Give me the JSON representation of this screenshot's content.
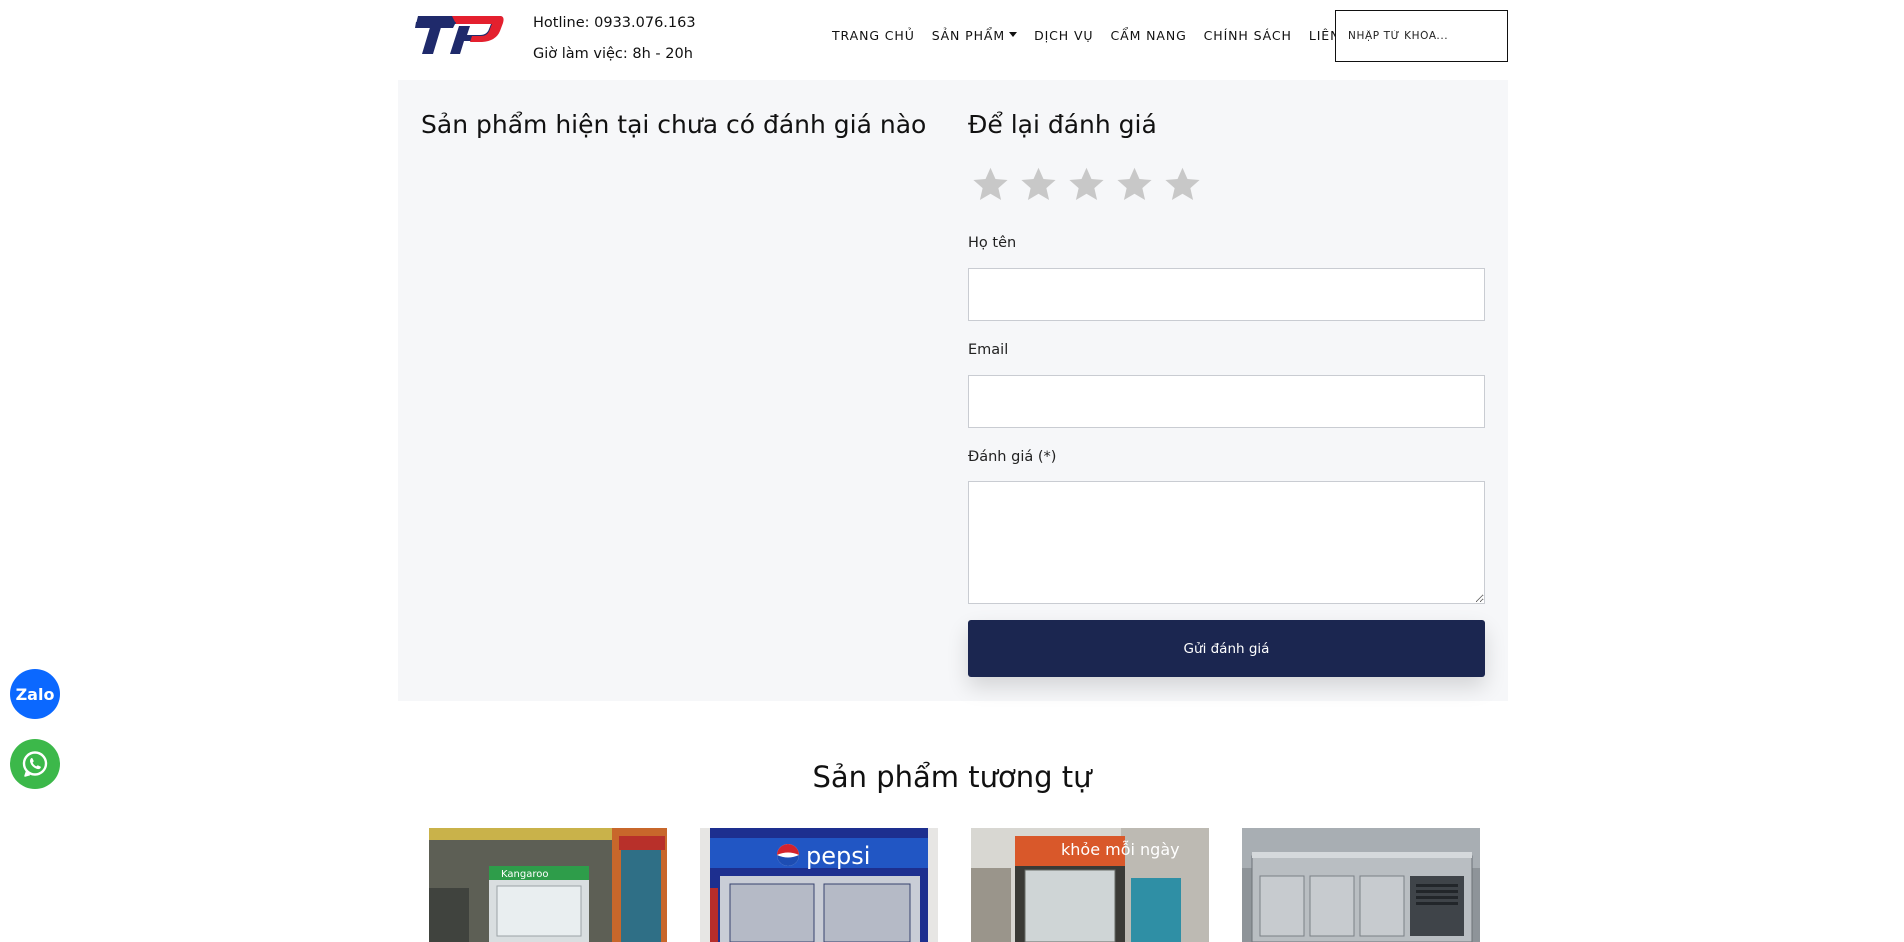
{
  "header": {
    "logo_text": "TP",
    "hotline": "Hotline: 0933.076.163",
    "hours": "Giờ làm việc: 8h - 20h",
    "nav": [
      {
        "label": "TRANG CHỦ"
      },
      {
        "label": "SẢN PHẨM"
      },
      {
        "label": "DỊCH VỤ"
      },
      {
        "label": "CẨM NANG"
      },
      {
        "label": "CHÍNH SÁCH"
      },
      {
        "label": "LIÊN HỆ"
      }
    ],
    "search_placeholder": "NHẬP TỪ KHÓA..."
  },
  "reviews": {
    "empty_message": "Sản phẩm hiện tại chưa có đánh giá nào",
    "form_title": "Để lại đánh giá",
    "rating": 0,
    "max_rating": 5,
    "name_label": "Họ tên",
    "name_value": "",
    "email_label": "Email",
    "email_value": "",
    "review_label": "Đánh giá (*)",
    "review_value": "",
    "submit_label": "Gửi đánh giá"
  },
  "floating": {
    "zalo_label": "Zalo"
  },
  "similar": {
    "title": "Sản phẩm tương tự",
    "products": [
      {
        "image_text": "Kangaroo"
      },
      {
        "image_text": "pepsi"
      },
      {
        "image_text": "khỏe mỗi ngày"
      },
      {
        "image_text": ""
      }
    ]
  },
  "colors": {
    "brand_navy": "#1b2650",
    "logo_red": "#e4202e",
    "panel_bg": "#f6f7f9",
    "star_inactive": "#c8c8c8",
    "zalo_blue": "#0b68ff",
    "whatsapp_green": "#3cb84a"
  },
  "icons": {
    "star": "star-icon",
    "zalo": "zalo-icon",
    "whatsapp": "whatsapp-icon",
    "dropdown": "caret-down-icon"
  }
}
